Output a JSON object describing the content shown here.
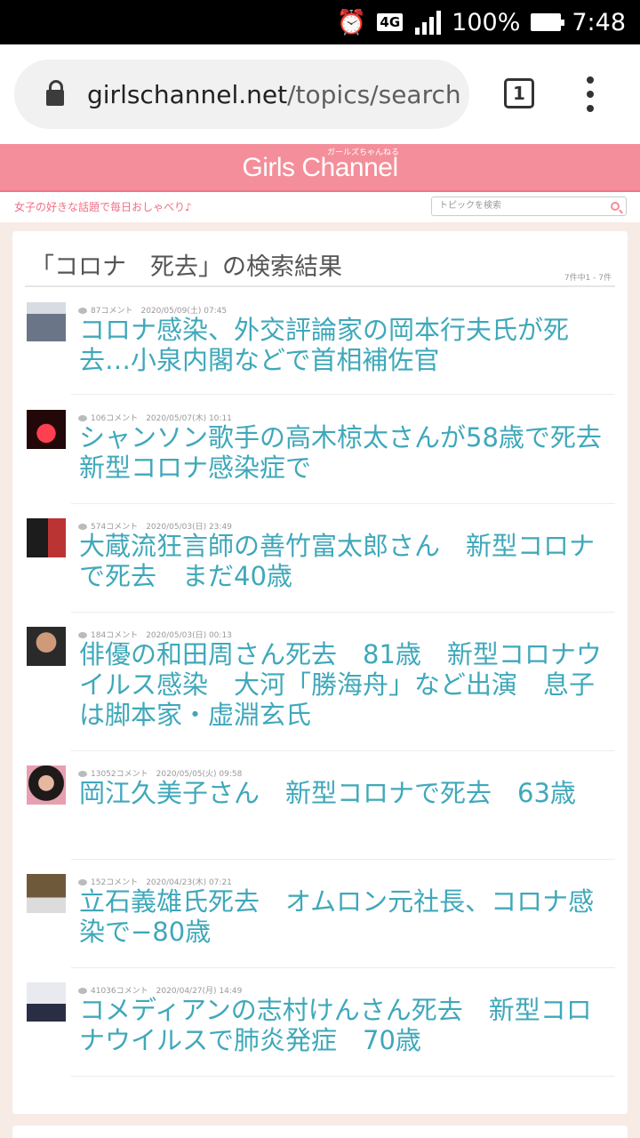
{
  "status_bar": {
    "network": "4G",
    "battery": "100%",
    "time": "7:48",
    "icons": [
      "alarm-icon",
      "signal-icon",
      "battery-icon"
    ]
  },
  "browser": {
    "url_domain": "girlschannel.net",
    "url_path": "/topics/search",
    "tab_count": "1",
    "icons": [
      "lock-icon",
      "menu-dots-icon"
    ]
  },
  "site": {
    "logo": "Girls Channel",
    "logo_kana": "ガールズちゃんねる",
    "tagline": "女子の好きな話題で毎日おしゃべり♪",
    "search_placeholder": "トピックを検索",
    "accent_color": "#f48e9a",
    "link_color": "#3fa8ba"
  },
  "results": {
    "heading": "「コロナ　死去」の検索結果",
    "count": "7件中1 - 7件",
    "topics": [
      {
        "comments": "87コメント",
        "date": "2020/05/09(土) 07:45",
        "title": "コロナ感染、外交評論家の岡本行夫氏が死去…小泉内閣などで首相補佐官"
      },
      {
        "comments": "106コメント",
        "date": "2020/05/07(木) 10:11",
        "title": "シャンソン歌手の高木椋太さんが58歳で死去 新型コロナ感染症で"
      },
      {
        "comments": "574コメント",
        "date": "2020/05/03(日) 23:49",
        "title": "大蔵流狂言師の善竹富太郎さん　新型コロナで死去　まだ40歳"
      },
      {
        "comments": "184コメント",
        "date": "2020/05/03(日) 00:13",
        "title": "俳優の和田周さん死去　81歳　新型コロナウイルス感染　大河「勝海舟」など出演　息子は脚本家・虚淵玄氏"
      },
      {
        "comments": "13052コメント",
        "date": "2020/05/05(火) 09:58",
        "title": "岡江久美子さん　新型コロナで死去　63歳"
      },
      {
        "comments": "152コメント",
        "date": "2020/04/23(木) 07:21",
        "title": "立石義雄氏死去　オムロン元社長、コロナ感染で−80歳"
      },
      {
        "comments": "41036コメント",
        "date": "2020/04/27(月) 14:49",
        "title": "コメディアンの志村けんさん死去　新型コロナウイルスで肺炎発症　70歳"
      }
    ]
  }
}
